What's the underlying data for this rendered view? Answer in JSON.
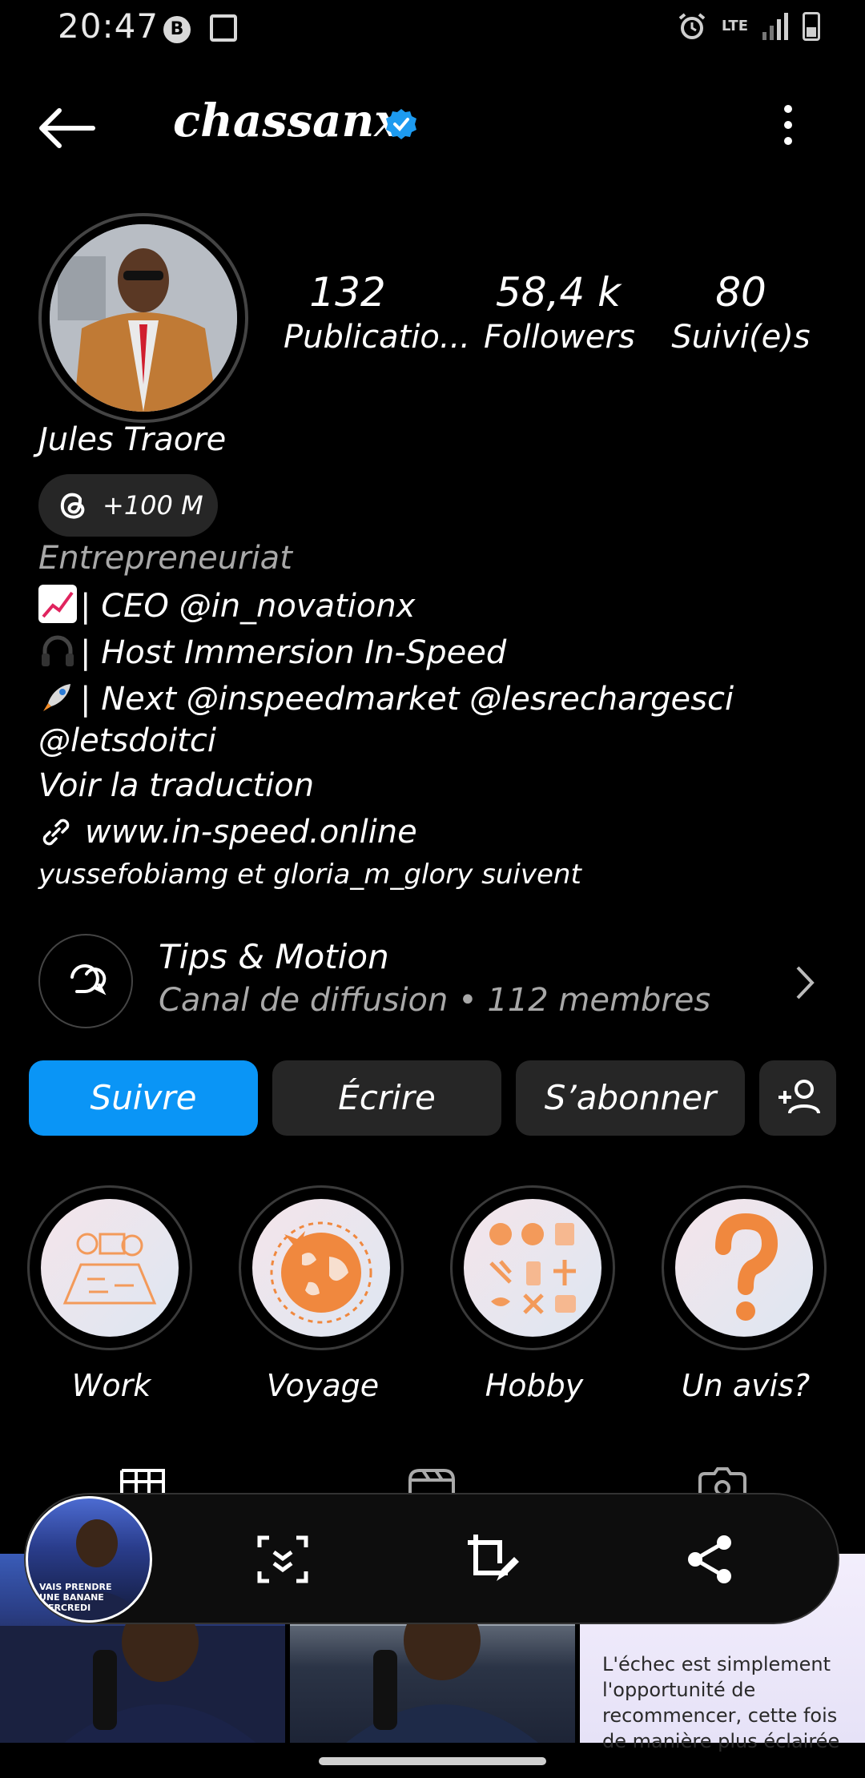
{
  "status_bar": {
    "time": "20:47",
    "network": "LTE"
  },
  "header": {
    "username": "chassanx"
  },
  "profile": {
    "stats": [
      {
        "value": "132",
        "label": "Publicatio..."
      },
      {
        "value": "58,4 k",
        "label": "Followers"
      },
      {
        "value": "80",
        "label": "Suivi(e)s"
      }
    ],
    "full_name": "Jules Traore",
    "threads_badge": "+100 M",
    "category": "Entrepreneuriat",
    "bio_lines": [
      "| CEO @in_novationx",
      "| Host Immersion In-Speed",
      "| Next @inspeedmarket @lesrechargesci",
      "@letsdoitci"
    ],
    "translate": "Voir la traduction",
    "link": "www.in-speed.online",
    "followed_by": "yussefobiamg et gloria_m_glory suivent"
  },
  "channel": {
    "title": "Tips & Motion",
    "subtitle": "Canal de diffusion • 112 membres"
  },
  "actions": {
    "follow": "Suivre",
    "message": "Écrire",
    "subscribe": "S’abonner"
  },
  "highlights": [
    {
      "label": "Work"
    },
    {
      "label": "Voyage"
    },
    {
      "label": "Hobby"
    },
    {
      "label": "Un avis?"
    }
  ],
  "posts": {
    "thumb_caption": "VAIS PRENDRE UNE BANANE MERCREDI",
    "quote": "L'échec est simplement l'opportunité de recommencer, cette fois de manière plus éclairée"
  },
  "colors": {
    "accent": "#0a95f6",
    "background": "#000000",
    "button": "#262626",
    "muted": "#a8a8a8"
  }
}
